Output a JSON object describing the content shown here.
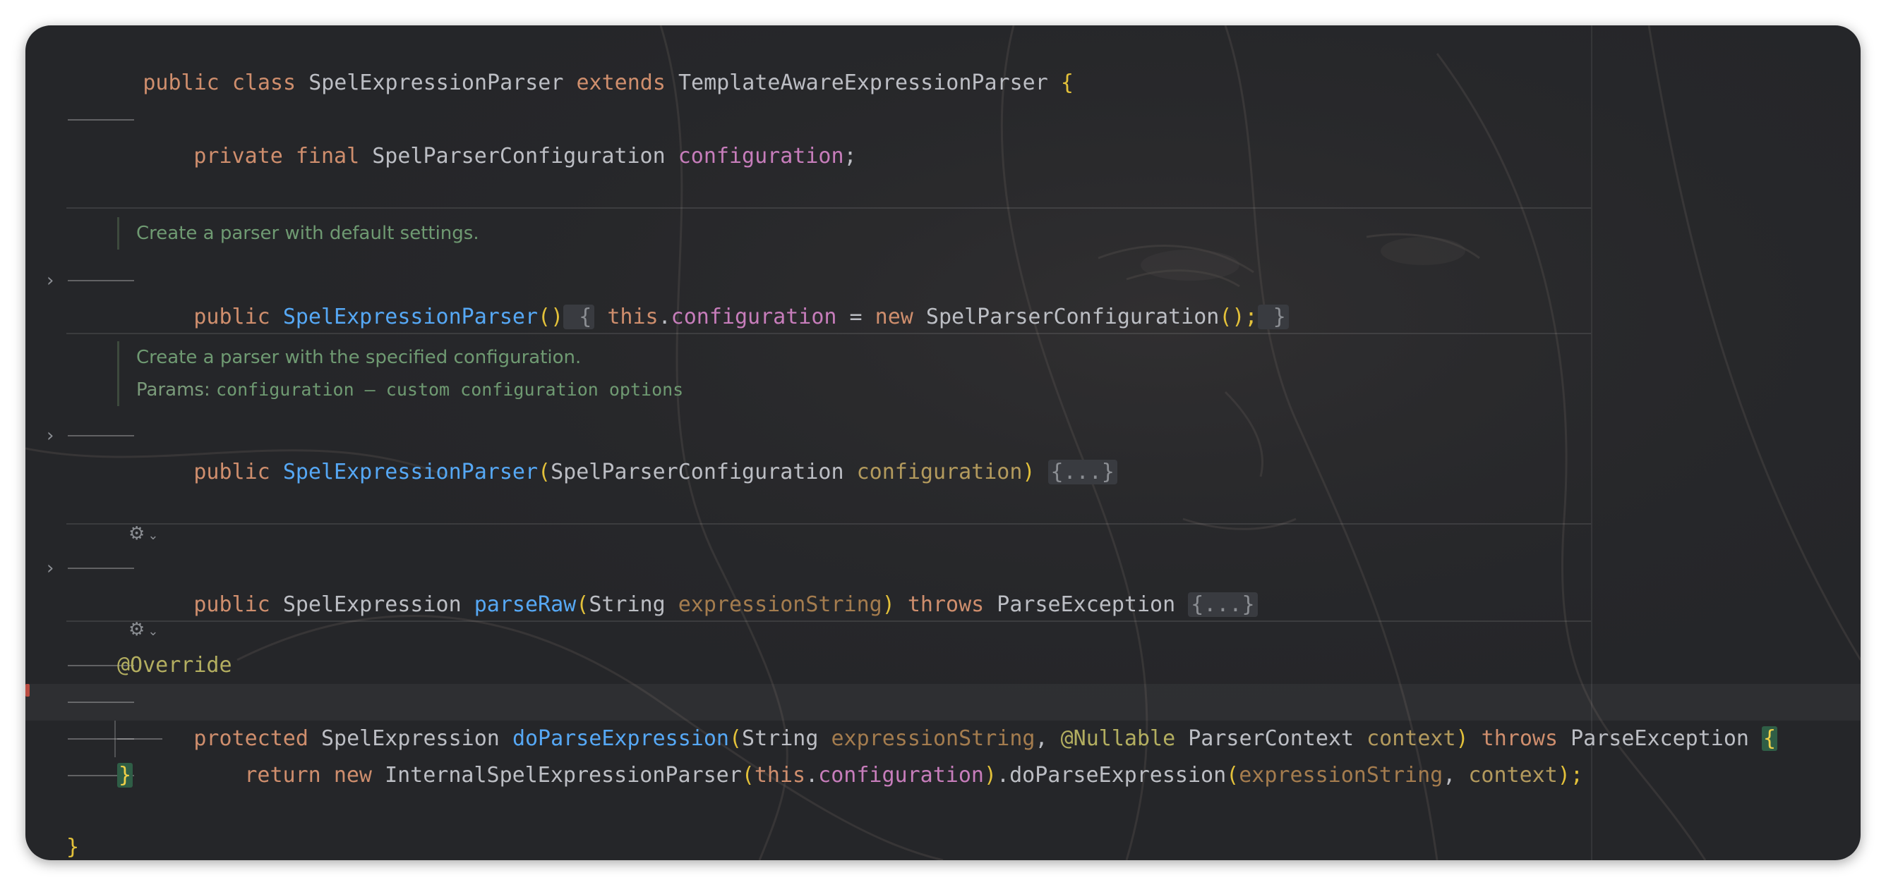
{
  "editor": {
    "lines": {
      "class_decl": [
        "public",
        "class",
        "SpelExpressionParser",
        "extends",
        "TemplateAwareExpressionParser",
        "{"
      ],
      "field_decl": [
        "private",
        "final",
        "SpelParserConfiguration",
        "configuration",
        ";"
      ],
      "doc1": "Create a parser with default settings.",
      "ctor1": [
        "public",
        "SpelExpressionParser",
        "()",
        "{",
        "this",
        ".",
        "configuration",
        " = ",
        "new",
        "SpelParserConfiguration",
        "();",
        "}"
      ],
      "doc2": "Create a parser with the specified configuration.",
      "doc2_params_label": "Params:",
      "doc2_params_value": "configuration – custom configuration options",
      "ctor2": [
        "public",
        "SpelExpressionParser",
        "(",
        "SpelParserConfiguration",
        "configuration",
        ")",
        "{...}"
      ],
      "parse_raw": [
        "public",
        "SpelExpression",
        "parseRaw",
        "(",
        "String",
        "expressionString",
        ")",
        "throws",
        "ParseException",
        "{...}"
      ],
      "override": "@Override",
      "do_parse": [
        "protected",
        "SpelExpression",
        "doParseExpression",
        "(",
        "String",
        "expressionString",
        ",",
        "@Nullable",
        "ParserContext",
        "context",
        ")",
        "throws",
        "ParseException",
        "{"
      ],
      "return_stmt": [
        "return",
        "new",
        "InternalSpelExpressionParser",
        "(",
        "this",
        ".",
        "configuration",
        ")",
        ".doParseExpression",
        "(",
        "expressionString",
        ",",
        "context",
        ");"
      ],
      "close_method": "}",
      "close_class": "}"
    },
    "icons": {
      "fold": "chevron-right-icon",
      "ai": "ai-assistant-icon",
      "dropdown": "chevron-down-icon"
    },
    "colors": {
      "background": "#252629",
      "keyword": "#cf8e6d",
      "function": "#56a8f5",
      "field": "#c77dbb",
      "parameter": "#a47c4e",
      "annotation": "#b3ae60",
      "brace": "#e3c13a",
      "doc_comment": "#6f9a72",
      "plain": "#bcbec4"
    }
  }
}
